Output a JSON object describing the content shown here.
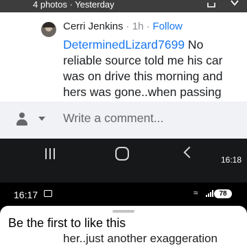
{
  "photo_header": {
    "meta": "4 photos · Yesterday"
  },
  "comment": {
    "author": "Cerri Jenkins",
    "time": "· 1h ·",
    "follow_label": "Follow",
    "mention": "DeterminedLizard7699",
    "text": " No reliable source told me his car was on drive this morning and hers was gone..when passing"
  },
  "composer": {
    "placeholder": "Write a comment..."
  },
  "nav_bar": {
    "clock": "16:18"
  },
  "inner_status": {
    "time": "16:17",
    "battery": "78"
  },
  "sheet": {
    "title": "Be the first to like this",
    "underlay_text": "her..just another exaggeration"
  }
}
